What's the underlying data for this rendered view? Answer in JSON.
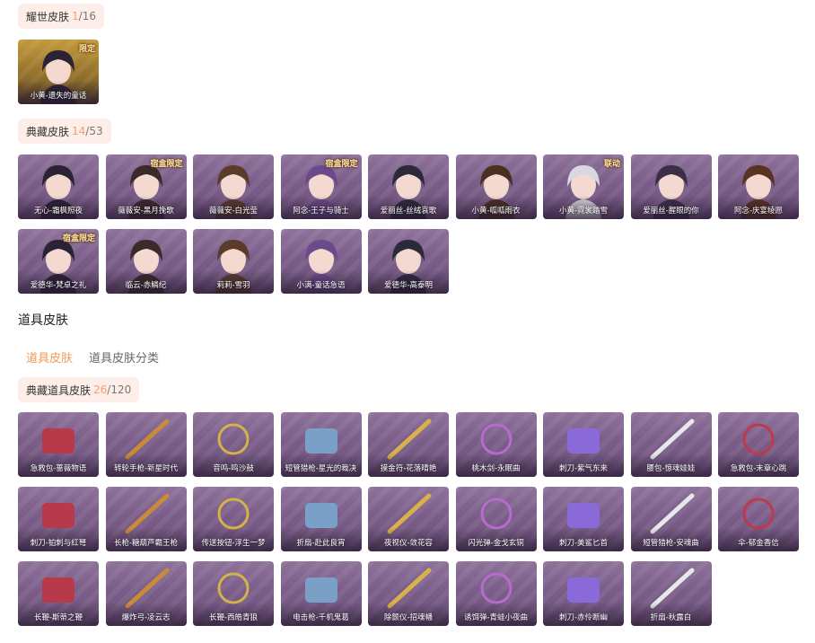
{
  "legend_skins": {
    "label": "耀世皮肤",
    "count": "1",
    "total": "/16"
  },
  "legend_items": [
    {
      "name": "小黄-遗失的童话",
      "tag": "限定"
    }
  ],
  "collection_skins": {
    "label": "典藏皮肤",
    "count": "14",
    "total": "/53"
  },
  "collection_items": [
    {
      "name": "无心-霜枫照夜",
      "tag": ""
    },
    {
      "name": "薇薇安-黑月挽歌",
      "tag": "宿盒限定"
    },
    {
      "name": "薇薇安-白光莹",
      "tag": ""
    },
    {
      "name": "阿念-王子与骑士",
      "tag": "宿盒限定"
    },
    {
      "name": "爱丽丝-丝绒哀歌",
      "tag": ""
    },
    {
      "name": "小黄-呱呱雨衣",
      "tag": ""
    },
    {
      "name": "小黄-霓裳踏雪",
      "tag": "联动"
    },
    {
      "name": "爱丽丝-腥眼的你",
      "tag": ""
    },
    {
      "name": "阿念-庆宴绫愿",
      "tag": ""
    },
    {
      "name": "爱德华-梵卓之礼",
      "tag": "宿盒限定"
    },
    {
      "name": "临云-赤鳞纪",
      "tag": ""
    },
    {
      "name": "莉莉-雪羽",
      "tag": ""
    },
    {
      "name": "小满-童话急语",
      "tag": ""
    },
    {
      "name": "爱德华-高泰明",
      "tag": ""
    }
  ],
  "props_section_title": "道具皮肤",
  "tabs": [
    {
      "label": "道具皮肤",
      "active": true
    },
    {
      "label": "道具皮肤分类",
      "active": false
    }
  ],
  "collection_props": {
    "label": "典藏道具皮肤",
    "count": "26",
    "total": "/120"
  },
  "prop_items": [
    {
      "name": "急救包-蔷薇物语"
    },
    {
      "name": "转轮手枪-新星时代"
    },
    {
      "name": "音鸣-鸣沙鼓"
    },
    {
      "name": "短管猎枪-星光的裁决"
    },
    {
      "name": "摸金符-花落晴艳"
    },
    {
      "name": "桃木剑-永眠曲"
    },
    {
      "name": "刺刀-紫气东来"
    },
    {
      "name": "腰包-惊魂娃娃"
    },
    {
      "name": "急救包-末章心跳"
    },
    {
      "name": "刺刀-铂刺与红弩"
    },
    {
      "name": "长枪-糖葫芦霸王枪"
    },
    {
      "name": "传送按钮-浮生一梦"
    },
    {
      "name": "折扇-赴此良宵"
    },
    {
      "name": "夜视仪-敛花容"
    },
    {
      "name": "闪光弹-金戈玄铜"
    },
    {
      "name": "刺刀-美鲨匕首"
    },
    {
      "name": "短管猎枪-安魂曲"
    },
    {
      "name": "伞-郁金香信"
    },
    {
      "name": "长鞭-斯蒂之鞭"
    },
    {
      "name": "爆炸弓-凌云志"
    },
    {
      "name": "长鞭-西皓青狼"
    },
    {
      "name": "电击枪-千机鬼葛"
    },
    {
      "name": "除颤仪-招魂幡"
    },
    {
      "name": "诱饵弹-青蛙小夜曲"
    },
    {
      "name": "刺刀-赤伶断幽"
    },
    {
      "name": "折扇-秋露白"
    }
  ],
  "colors": {
    "accent": "#f09a55",
    "badge_bg": "#fdeee9",
    "card_bg": "#7a5d89"
  }
}
